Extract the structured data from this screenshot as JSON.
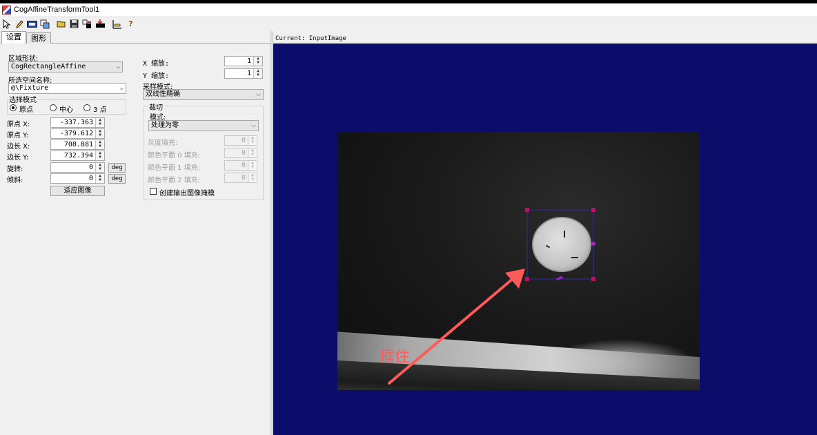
{
  "window": {
    "title": "CogAffineTransformTool1"
  },
  "toolbar": {
    "icons": [
      "pointer-icon",
      "pencil-icon",
      "image-view-icon",
      "copy-icon",
      "open-folder-icon",
      "save-icon",
      "layout-icon",
      "import-icon",
      "ruler-icon",
      "help-icon"
    ]
  },
  "tabs": [
    {
      "label": "设置",
      "active": true
    },
    {
      "label": "图形",
      "active": false
    }
  ],
  "settings": {
    "region_shape_label": "区域形状:",
    "region_shape_value": "CogRectangleAffine",
    "selected_space_label": "所选空间名称:",
    "selected_space_value": "@\\Fixture",
    "selection_mode_label": "选择模式",
    "radio_origin": "原点",
    "radio_center": "中心",
    "radio_three_point": "3 点",
    "fields": [
      {
        "label": "原点 X:",
        "value": "-337.363"
      },
      {
        "label": "原点 Y:",
        "value": "-379.612"
      },
      {
        "label": "边长 X:",
        "value": "708.881"
      },
      {
        "label": "边长 Y:",
        "value": "732.394"
      },
      {
        "label": "旋转:",
        "value": "0",
        "unit": "deg"
      },
      {
        "label": "倾斜:",
        "value": "0",
        "unit": "deg"
      }
    ],
    "fit_image_button": "适应图像",
    "x_scale_label": "X 缩放:",
    "x_scale_value": "1",
    "y_scale_label": "Y 缩放:",
    "y_scale_value": "1",
    "sampling_mode_label": "采样模式:",
    "sampling_mode_value": "双线性精确",
    "crop_group_label": "裁切",
    "crop_mode_label": "模式:",
    "crop_mode_value": "处理为零",
    "fill_fields": [
      {
        "label": "灰度填充:",
        "value": "0"
      },
      {
        "label": "颜色平面 0 填充:",
        "value": "0"
      },
      {
        "label": "颜色平面 1 填充:",
        "value": "0"
      },
      {
        "label": "颜色平面 2 填充:",
        "value": "0"
      }
    ],
    "create_mask_label": "创建输出图像掩模",
    "create_mask_checked": false
  },
  "image_pane": {
    "current_label": "Current: InputImage",
    "background_color": "#0c0c6a",
    "annotation_text": "框住",
    "annotation_color": "#ff5a5a",
    "roi_color": "#c01060"
  }
}
